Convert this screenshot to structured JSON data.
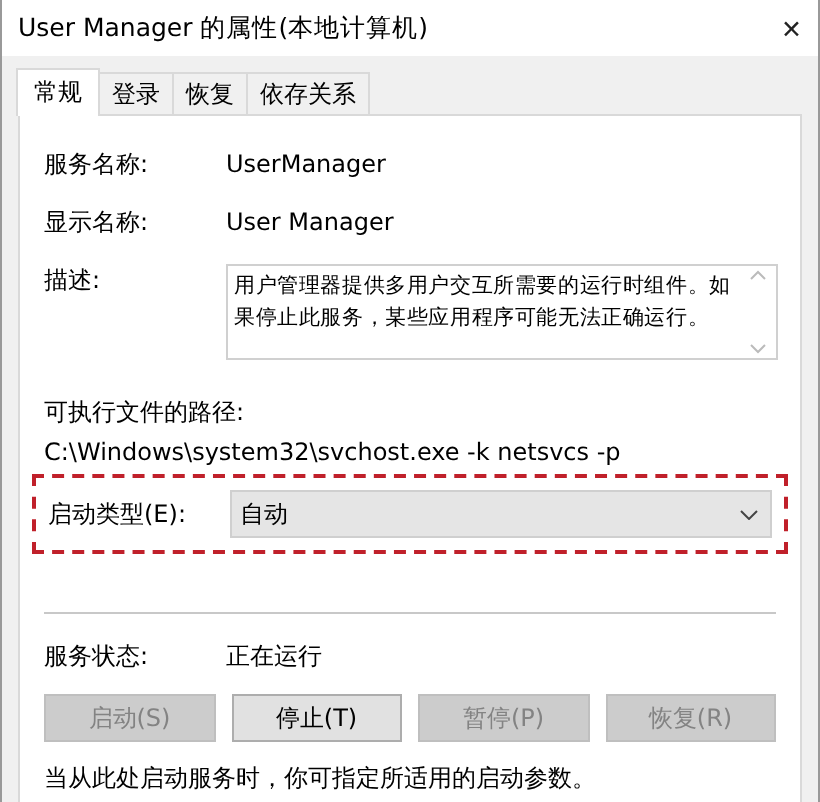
{
  "window": {
    "title": "User Manager 的属性(本地计算机)",
    "close": "✕"
  },
  "tabs": [
    {
      "label": "常规",
      "selected": true
    },
    {
      "label": "登录",
      "selected": false
    },
    {
      "label": "恢复",
      "selected": false
    },
    {
      "label": "依存关系",
      "selected": false
    }
  ],
  "service_name": {
    "label": "服务名称:",
    "value": "UserManager"
  },
  "display_name": {
    "label": "显示名称:",
    "value": "User Manager"
  },
  "description": {
    "label": "描述:",
    "value": "用户管理器提供多用户交互所需要的运行时组件。如果停止此服务，某些应用程序可能无法正确运行。"
  },
  "executable_path": {
    "label": "可执行文件的路径:",
    "value": "C:\\Windows\\system32\\svchost.exe -k netsvcs -p"
  },
  "startup_type": {
    "label": "启动类型(E):",
    "value": "自动",
    "highlighted": true
  },
  "service_status": {
    "label": "服务状态:",
    "value": "正在运行"
  },
  "buttons": [
    {
      "label": "启动(S)",
      "disabled": true
    },
    {
      "label": "停止(T)",
      "disabled": false
    },
    {
      "label": "暂停(P)",
      "disabled": true
    },
    {
      "label": "恢复(R)",
      "disabled": true
    }
  ],
  "note": "当从此处启动服务时，你可指定所适用的启动参数。"
}
